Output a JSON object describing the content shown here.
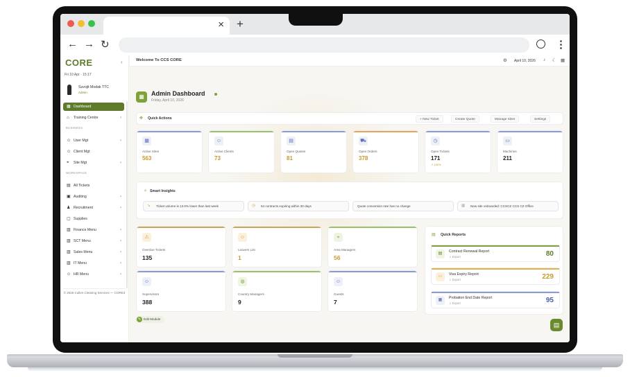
{
  "browser": {
    "tab_close": "×",
    "new_tab": "+",
    "nav_back": "←",
    "nav_forward": "→",
    "nav_reload": "↻",
    "star": "☆",
    "profile_icon": "profile-icon",
    "menu_icon": "⋮"
  },
  "sidebar": {
    "logo": "C🟡RE",
    "logo_text": "CORE",
    "collapse": "‹",
    "date": "Fri 10 Apr · 15:17",
    "user_name": "Suvojit Modak TTC",
    "user_role": "Admin",
    "sections": {
      "business": "BUSINESS",
      "workspace": "WORKSPACE"
    },
    "items": [
      {
        "label": "Dashboard",
        "icon": "▦",
        "chev": ""
      },
      {
        "label": "Training Centre",
        "icon": "⌂",
        "chev": "›"
      },
      {
        "label": "User Mgt",
        "icon": "☺",
        "chev": "›"
      },
      {
        "label": "Client Mgt",
        "icon": "☺",
        "chev": ""
      },
      {
        "label": "Site Mgt",
        "icon": "⌖",
        "chev": "›"
      },
      {
        "label": "All Tickets",
        "icon": "▤",
        "chev": ""
      },
      {
        "label": "Auditing",
        "icon": "▣",
        "chev": "›"
      },
      {
        "label": "Recruitment",
        "icon": "♟",
        "chev": "›"
      },
      {
        "label": "Supplies",
        "icon": "▢",
        "chev": ""
      },
      {
        "label": "Finance Menu",
        "icon": "▥",
        "chev": "›"
      },
      {
        "label": "SCT Menu",
        "icon": "▥",
        "chev": "›"
      },
      {
        "label": "Sales Menu",
        "icon": "▥",
        "chev": "›"
      },
      {
        "label": "IT Menu",
        "icon": "▥",
        "chev": "›"
      },
      {
        "label": "HR Menu",
        "icon": "☺",
        "chev": "›"
      }
    ],
    "copyright": "© 2026 Cullen Cleaning Services — CORE3"
  },
  "topbar": {
    "welcome": "Welcome To CCS CORE",
    "date": "April 10, 2026"
  },
  "header": {
    "title": "Admin Dashboard",
    "subtitle": "Friday, April 10, 2026"
  },
  "quick_actions": {
    "title": "Quick Actions",
    "buttons": [
      "+ New Ticket",
      "Create Quote",
      "Manage Sites",
      "Settings"
    ]
  },
  "stats": [
    {
      "label": "Active Sites",
      "value": "563",
      "color": "#c79a2e",
      "bar": "#8a9ad8",
      "icon": "▦"
    },
    {
      "label": "Active Clients",
      "value": "73",
      "color": "#c79a2e",
      "bar": "#9bc16a",
      "icon": "☺"
    },
    {
      "label": "Open Quotes",
      "value": "81",
      "color": "#c79a2e",
      "bar": "#8a9ad8",
      "icon": "▤"
    },
    {
      "label": "Open Orders",
      "value": "378",
      "color": "#c79a2e",
      "bar": "#e8a35a",
      "icon": "⛟"
    },
    {
      "label": "Open Tickets",
      "value": "171",
      "color": "#222222",
      "bar": "#8a9ad8",
      "icon": "◷",
      "note": "↗ 100%"
    },
    {
      "label": "Machines",
      "value": "211",
      "color": "#222222",
      "bar": "#8a9ad8",
      "icon": "▭"
    }
  ],
  "smart_insights": {
    "title": "Smart Insights",
    "pills": [
      {
        "icon": "↘",
        "text": "Ticket volume is 13.6% lower than last week"
      },
      {
        "icon": "◷",
        "text": "54 contracts expiring within 30 days"
      },
      {
        "icon": "",
        "text": "Quote conversion rate has no change"
      },
      {
        "icon": "▥",
        "text": "New site onboarded: CCSCZ CCS CZ Office"
      }
    ]
  },
  "big_cards": [
    {
      "label": "Overdue Tickets",
      "value": "135",
      "color": "#222222",
      "bar": "#c9a85a",
      "icon": "⚠"
    },
    {
      "label": "Leavers List",
      "value": "1",
      "color": "#c79a2e",
      "bar": "#c9a85a",
      "icon": "☺"
    },
    {
      "label": "Area Managers",
      "value": "56",
      "color": "#c79a2e",
      "bar": "#9bc16a",
      "icon": "⌖"
    },
    {
      "label": "Supervisors",
      "value": "388",
      "color": "#222222",
      "bar": "#8a9ad8",
      "icon": "☺"
    },
    {
      "label": "Country Managers",
      "value": "9",
      "color": "#222222",
      "bar": "#9bc16a",
      "icon": "◍"
    },
    {
      "label": "Guests",
      "value": "7",
      "color": "#222222",
      "bar": "#8a9ad8",
      "icon": "☺"
    }
  ],
  "quick_reports": {
    "title": "Quick Reports",
    "items": [
      {
        "name": "Contract Renewal Report",
        "export": "⇩ Export",
        "value": "80",
        "color": "#5e7a2a",
        "bar": "#7fa13a",
        "icon": "▤"
      },
      {
        "name": "Visa Expiry Report",
        "export": "⇩ Export",
        "value": "229",
        "color": "#c79a2e",
        "bar": "#e0b24d",
        "icon": "▭"
      },
      {
        "name": "Probation End Date Report",
        "export": "⇩ Export",
        "value": "95",
        "color": "#4a5fa8",
        "bar": "#8a9ad8",
        "icon": "▦"
      }
    ]
  },
  "footer": {
    "edit_modules": "Edit Module"
  }
}
